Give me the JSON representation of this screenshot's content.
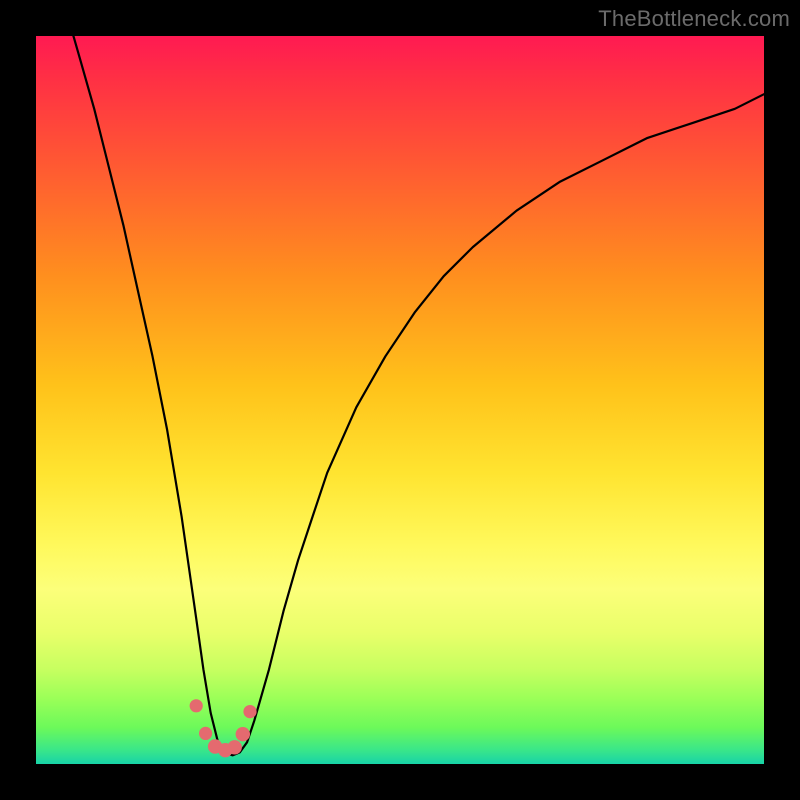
{
  "watermark": {
    "text": "TheBottleneck.com"
  },
  "colors": {
    "frame": "#000000",
    "curve": "#000000",
    "dots": "#e46a6f",
    "gradient_stops": [
      "#ff1a52",
      "#ff3044",
      "#ff5a32",
      "#ff8f1e",
      "#ffc21a",
      "#ffe430",
      "#fff95c",
      "#fcff7a",
      "#e9ff6a",
      "#c7ff60",
      "#9bff58",
      "#6cf95a",
      "#3be788",
      "#17d3a8"
    ]
  },
  "chart_data": {
    "type": "line",
    "title": "",
    "xlabel": "",
    "ylabel": "",
    "xlim": [
      0,
      100
    ],
    "ylim": [
      0,
      100
    ],
    "grid": false,
    "legend": false,
    "series": [
      {
        "name": "bottleneck-curve",
        "x": [
          2,
          4,
          6,
          8,
          10,
          12,
          14,
          16,
          18,
          20,
          21,
          22,
          23,
          24,
          25,
          26,
          27,
          28,
          29,
          30,
          32,
          34,
          36,
          38,
          40,
          44,
          48,
          52,
          56,
          60,
          66,
          72,
          78,
          84,
          90,
          96,
          100
        ],
        "y": [
          110,
          104,
          97,
          90,
          82,
          74,
          65,
          56,
          46,
          34,
          27,
          20,
          13,
          7,
          3,
          1.5,
          1.2,
          1.6,
          3,
          6,
          13,
          21,
          28,
          34,
          40,
          49,
          56,
          62,
          67,
          71,
          76,
          80,
          83,
          86,
          88,
          90,
          92
        ]
      }
    ],
    "points": [
      {
        "name": "dot-1",
        "x": 22.0,
        "y": 8.0,
        "r": 1.0
      },
      {
        "name": "dot-2",
        "x": 23.3,
        "y": 4.2,
        "r": 1.0
      },
      {
        "name": "dot-3",
        "x": 24.6,
        "y": 2.4,
        "r": 1.1
      },
      {
        "name": "dot-4",
        "x": 26.0,
        "y": 1.9,
        "r": 1.1
      },
      {
        "name": "dot-5",
        "x": 27.3,
        "y": 2.3,
        "r": 1.1
      },
      {
        "name": "dot-6",
        "x": 28.4,
        "y": 4.1,
        "r": 1.1
      },
      {
        "name": "dot-7",
        "x": 29.4,
        "y": 7.2,
        "r": 1.0
      }
    ]
  }
}
